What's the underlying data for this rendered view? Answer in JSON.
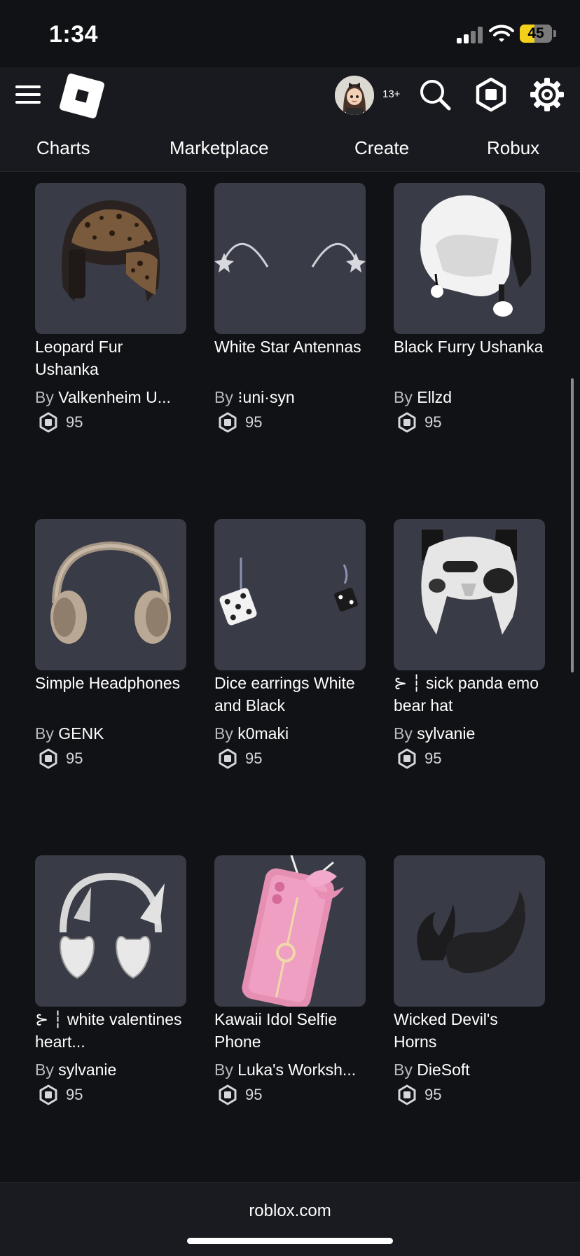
{
  "status_bar": {
    "time": "1:34",
    "battery": "45"
  },
  "header": {
    "age_badge": "13+",
    "nav": [
      "Charts",
      "Marketplace",
      "Create",
      "Robux"
    ]
  },
  "items": [
    {
      "name": "Leopard Fur Ushanka",
      "by": "By",
      "creator": "Valkenheim U...",
      "price": "95"
    },
    {
      "name": "White Star Antennas",
      "by": "By",
      "creator": "⁝uni·syn",
      "price": "95"
    },
    {
      "name": "Black Furry Ushanka",
      "by": "By",
      "creator": "Ellzd",
      "price": "95"
    },
    {
      "name": "Simple Headphones",
      "by": "By",
      "creator": "GENK",
      "price": "95"
    },
    {
      "name": "Dice earrings White and Black",
      "by": "By",
      "creator": "k0maki",
      "price": "95"
    },
    {
      "name": "⊱ ┆ sick panda emo bear hat",
      "by": "By",
      "creator": "sylvanie",
      "price": "95"
    },
    {
      "name": "⊱ ┆ white valentines heart...",
      "by": "By",
      "creator": "sylvanie",
      "price": "95"
    },
    {
      "name": "Kawaii Idol Selfie Phone",
      "by": "By",
      "creator": "Luka's Worksh...",
      "price": "95"
    },
    {
      "name": "Wicked Devil's Horns",
      "by": "By",
      "creator": "DieSoft",
      "price": "95"
    }
  ],
  "footer": {
    "domain": "roblox.com"
  },
  "icons": {
    "menu": "hamburger-icon",
    "logo": "roblox-logo",
    "search": "search-icon",
    "robux": "robux-icon",
    "settings": "gear-icon"
  },
  "colors": {
    "background": "#111216",
    "header": "#191a1f",
    "card": "#393b46",
    "battery": "#f3d01a"
  }
}
